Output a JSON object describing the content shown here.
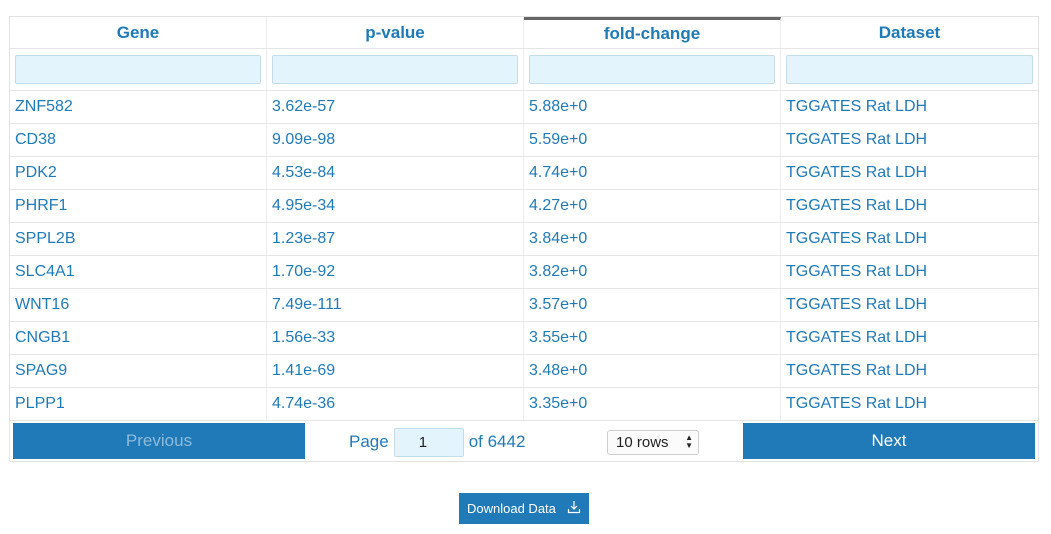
{
  "columns": [
    {
      "label": "Gene"
    },
    {
      "label": "p-value"
    },
    {
      "label": "fold-change"
    },
    {
      "label": "Dataset"
    }
  ],
  "rows": [
    {
      "gene": "ZNF582",
      "pvalue": "3.62e-57",
      "fold_change": "5.88e+0",
      "dataset": "TGGATES Rat LDH"
    },
    {
      "gene": "CD38",
      "pvalue": "9.09e-98",
      "fold_change": "5.59e+0",
      "dataset": "TGGATES Rat LDH"
    },
    {
      "gene": "PDK2",
      "pvalue": "4.53e-84",
      "fold_change": "4.74e+0",
      "dataset": "TGGATES Rat LDH"
    },
    {
      "gene": "PHRF1",
      "pvalue": "4.95e-34",
      "fold_change": "4.27e+0",
      "dataset": "TGGATES Rat LDH"
    },
    {
      "gene": "SPPL2B",
      "pvalue": "1.23e-87",
      "fold_change": "3.84e+0",
      "dataset": "TGGATES Rat LDH"
    },
    {
      "gene": "SLC4A1",
      "pvalue": "1.70e-92",
      "fold_change": "3.82e+0",
      "dataset": "TGGATES Rat LDH"
    },
    {
      "gene": "WNT16",
      "pvalue": "7.49e-111",
      "fold_change": "3.57e+0",
      "dataset": "TGGATES Rat LDH"
    },
    {
      "gene": "CNGB1",
      "pvalue": "1.56e-33",
      "fold_change": "3.55e+0",
      "dataset": "TGGATES Rat LDH"
    },
    {
      "gene": "SPAG9",
      "pvalue": "1.41e-69",
      "fold_change": "3.48e+0",
      "dataset": "TGGATES Rat LDH"
    },
    {
      "gene": "PLPP1",
      "pvalue": "4.74e-36",
      "fold_change": "3.35e+0",
      "dataset": "TGGATES Rat LDH"
    }
  ],
  "pagination": {
    "previous_label": "Previous",
    "next_label": "Next",
    "page_label": "Page",
    "current_page": "1",
    "of_total": "of 6442",
    "rows_select": "10 rows"
  },
  "download": {
    "label": "Download Data",
    "icon": "download-icon"
  },
  "colors": {
    "accent": "#217ab8",
    "text": "#1f7ab8",
    "input_bg": "#e4f4fc"
  }
}
